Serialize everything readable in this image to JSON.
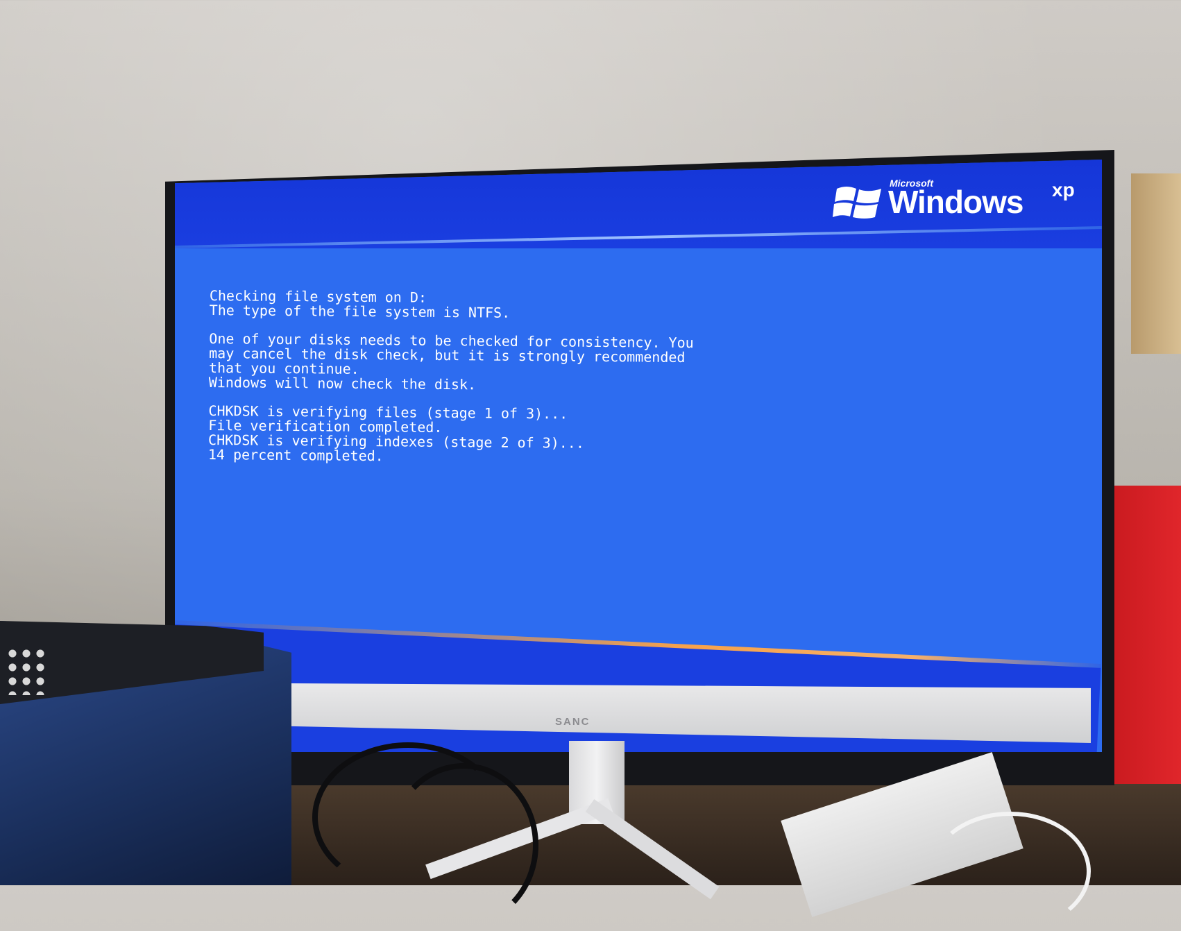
{
  "screen": {
    "logo": {
      "microsoft": "Microsoft",
      "windows": "Windows",
      "xp": "xp"
    },
    "console_lines": [
      "Checking file system on D:",
      "The type of the file system is NTFS.",
      "",
      "One of your disks needs to be checked for consistency. You",
      "may cancel the disk check, but it is strongly recommended",
      "that you continue.",
      "Windows will now check the disk.",
      "",
      "CHKDSK is verifying files (stage 1 of 3)...",
      "File verification completed.",
      "CHKDSK is verifying indexes (stage 2 of 3)...",
      "14 percent completed."
    ],
    "colors": {
      "band": "#1a3ee0",
      "body": "#2d6cf0",
      "text": "#ffffff",
      "accent_line": "#f7a24a"
    }
  },
  "monitor": {
    "brand": "SANC"
  }
}
